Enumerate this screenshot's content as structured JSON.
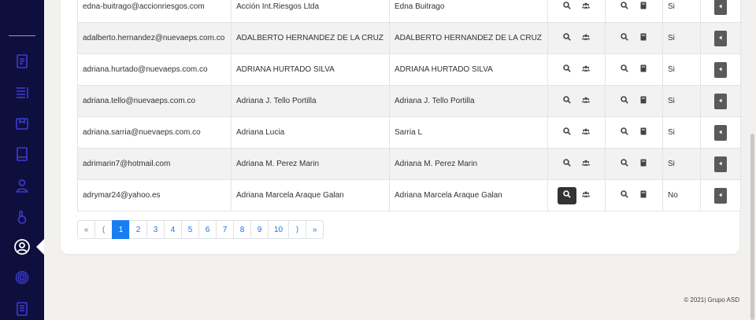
{
  "sidebar": {
    "items": [
      {
        "icon": "document-icon",
        "active": false
      },
      {
        "icon": "list-icon",
        "active": false
      },
      {
        "icon": "package-icon",
        "active": false
      },
      {
        "icon": "book-icon",
        "active": false
      },
      {
        "icon": "user-icon",
        "active": false
      },
      {
        "icon": "hand-icon",
        "active": false
      },
      {
        "icon": "user-circle-icon",
        "active": true
      },
      {
        "icon": "fingerprint-icon",
        "active": false
      },
      {
        "icon": "notebook-icon",
        "active": false
      }
    ]
  },
  "table": {
    "rows": [
      {
        "email": "edna-buitrago@accionriesgos.com",
        "company": "Acción Int.Riesgos Ltda",
        "name": "Edna Buitrago",
        "status": "Si"
      },
      {
        "email": "adalberto.hernandez@nuevaeps.com.co",
        "company": "ADALBERTO HERNANDEZ DE LA CRUZ",
        "name": "ADALBERTO HERNANDEZ DE LA CRUZ",
        "status": "Si"
      },
      {
        "email": "adriana.hurtado@nuevaeps.com.co",
        "company": "ADRIANA HURTADO SILVA",
        "name": "ADRIANA HURTADO SILVA",
        "status": "Si"
      },
      {
        "email": "adriana.tello@nuevaeps.com.co",
        "company": "Adriana J. Tello Portilla",
        "name": "Adriana J. Tello Portilla",
        "status": "Si"
      },
      {
        "email": "adriana.sarria@nuevaeps.com.co",
        "company": "Adriana Lucia",
        "name": "Sarria L",
        "status": "Si"
      },
      {
        "email": "adrimarin7@hotmail.com",
        "company": "Adriana M. Perez Marin",
        "name": "Adriana M. Perez Marin",
        "status": "Si"
      },
      {
        "email": "adrymar24@yahoo.es",
        "company": "Adriana Marcela Araque Galan",
        "name": "Adriana Marcela Araque Galan",
        "status": "No"
      }
    ],
    "icons": {
      "search": "search-icon",
      "group": "group-icon",
      "book": "book-icon",
      "action": "caret-left-icon"
    }
  },
  "pagination": {
    "first": "«",
    "prev": "(",
    "pages": [
      "1",
      "2",
      "3",
      "4",
      "5",
      "6",
      "7",
      "8",
      "9",
      "10"
    ],
    "current": "1",
    "next": "⟩",
    "last": "»"
  },
  "footer": {
    "text": "© 2021| Grupo ASD"
  },
  "colors": {
    "sidebar": "#0f0f3e",
    "sidebar_icon": "#3b3bd6",
    "active_page": "#1a7ef0",
    "link": "#1a73e8"
  }
}
